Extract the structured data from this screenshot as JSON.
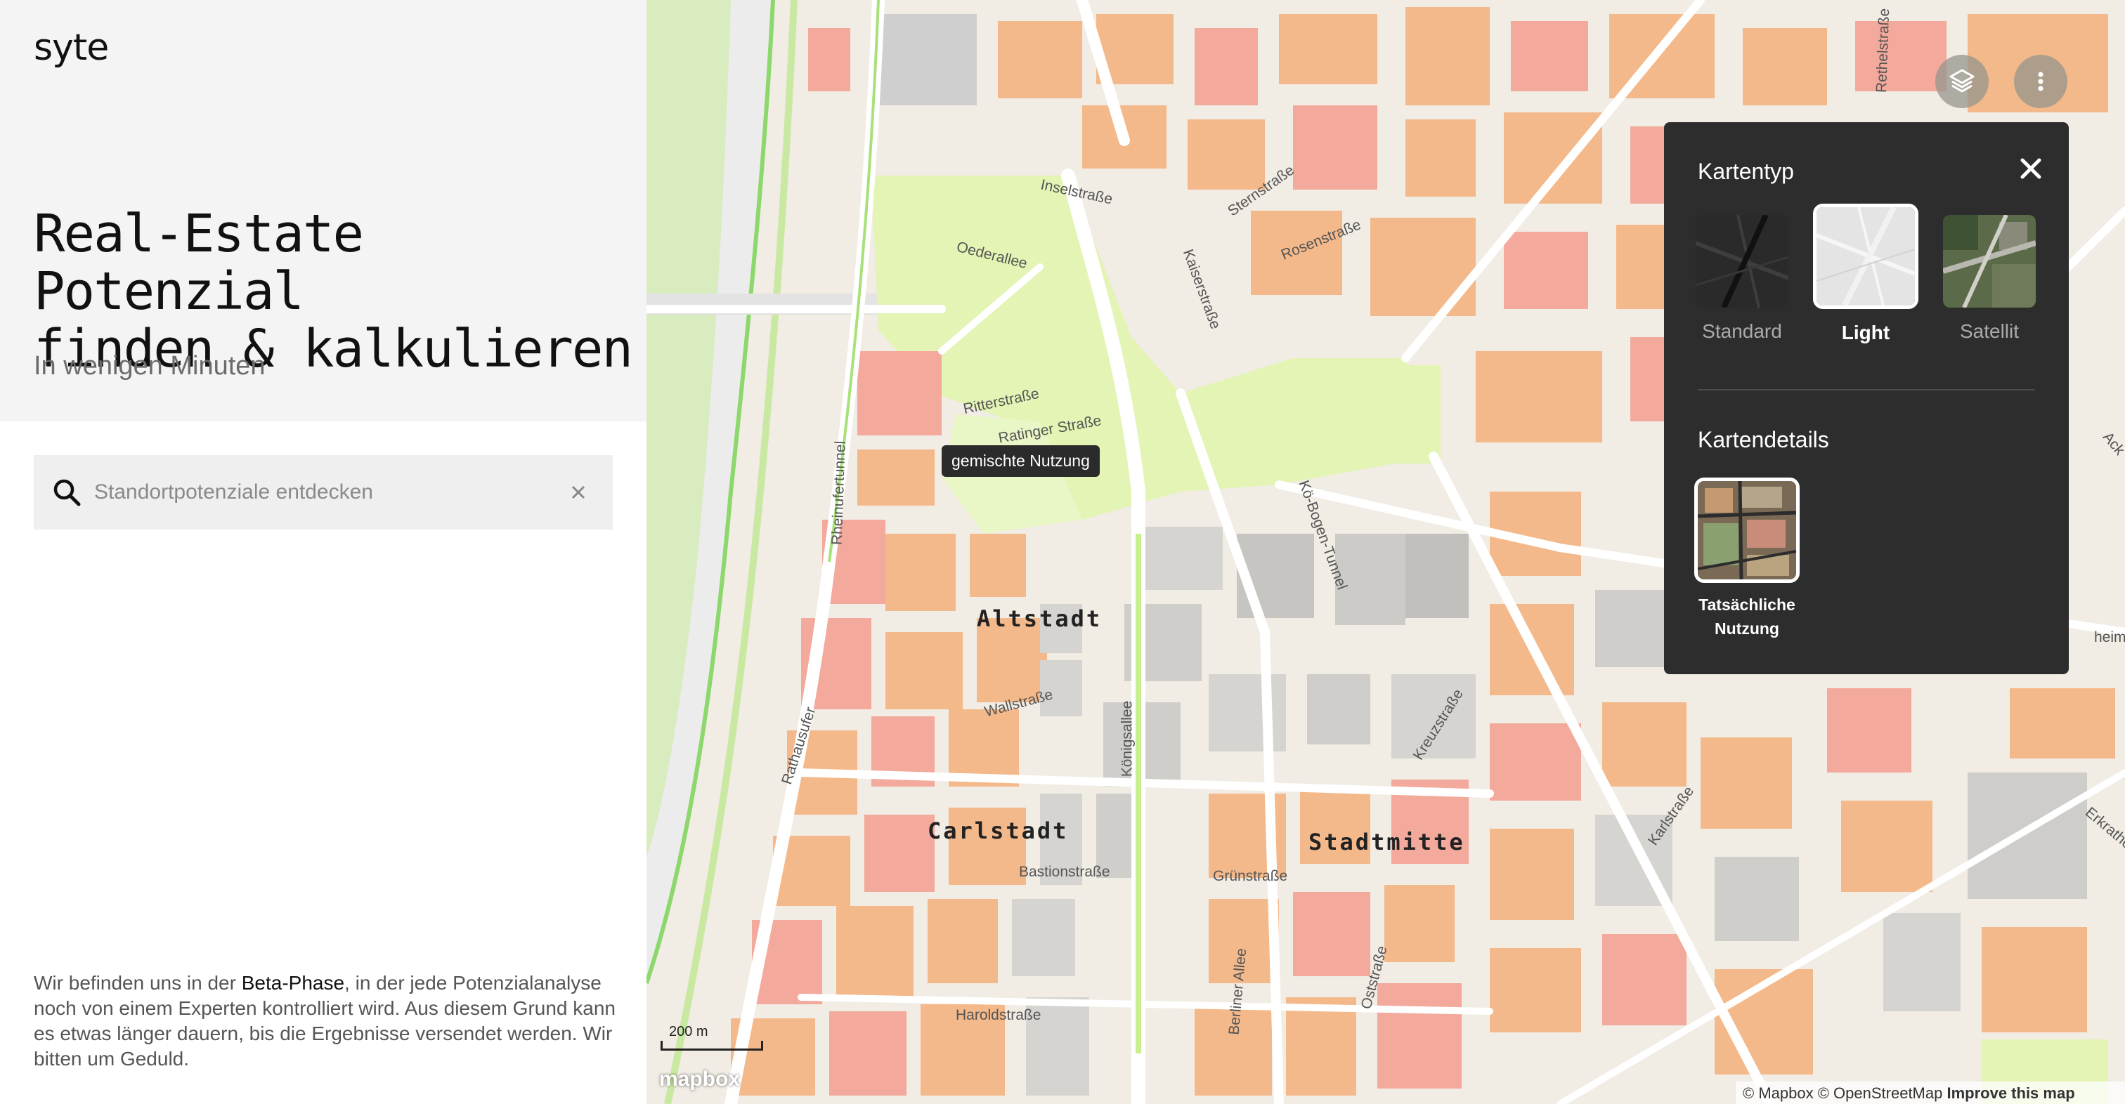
{
  "sidebar": {
    "logo": "syte",
    "headline_line1": "Real-Estate Potenzial",
    "headline_line2": "finden & kalkulieren",
    "subline": "In wenigen Minuten",
    "search": {
      "placeholder": "Standortpotenziale entdecken",
      "value": ""
    },
    "beta_note": {
      "part1": "Wir befinden uns in der ",
      "strong": "Beta-Phase",
      "part2": ", in der jede Potenzialanalyse noch von einem Experten kontrolliert wird. Aus diesem Grund kann es etwas länger dauern, bis die Ergebnisse versendet werden. Wir bitten um Geduld."
    }
  },
  "map": {
    "districts": [
      "Altstadt",
      "Carlstadt",
      "Stadtmitte"
    ],
    "streets": {
      "inselstrasse": "Inselstraße",
      "oederallee": "Oederallee",
      "sternstrasse": "Sternstraße",
      "rosenstrasse": "Rosenstraße",
      "kaiserstrasse": "Kaiserstraße",
      "ritterstrasse": "Ritterstraße",
      "ratinger": "Ratinger Straße",
      "rheinufertunnel": "Rheinufertunnel",
      "ko_bogen": "Kö-Bogen-Tunnel",
      "rathausufer": "Rathausufer",
      "wallstrasse": "Wallstraße",
      "koenigsallee": "Königsallee",
      "kreuzstrasse": "Kreuzstraße",
      "karlstrasse": "Karlstraße",
      "bastionstrasse": "Bastionstraße",
      "gruenstrasse": "Grünstraße",
      "haroldstrasse": "Haroldstraße",
      "berliner_allee": "Berliner Allee",
      "oststrasse": "Oststraße",
      "rethelstrasse": "Rethelstraße",
      "erkrather": "Erkrather",
      "heimer": "heimer Str",
      "ack": "Ack"
    },
    "tooltip": "gemischte Nutzung",
    "scale": "200 m",
    "mapbox_logo": "mapbox",
    "attribution": {
      "mapbox": "© Mapbox",
      "osm": "© OpenStreetMap",
      "improve": "Improve this map"
    },
    "icons": {
      "layers": "layers-icon",
      "more": "more-vertical-icon"
    }
  },
  "panel": {
    "title_type": "Kartentyp",
    "types": [
      {
        "label": "Standard",
        "selected": false
      },
      {
        "label": "Light",
        "selected": true
      },
      {
        "label": "Satellit",
        "selected": false
      }
    ],
    "title_details": "Kartendetails",
    "detail": {
      "line1": "Tatsächliche",
      "line2": "Nutzung"
    }
  },
  "colors": {
    "residential": "#f4b98a",
    "commercial": "#f3a99b",
    "green": "#dff3a6",
    "water": "#d6e9b8",
    "road": "#ffffff",
    "panel_bg": "#2d2d2d"
  }
}
